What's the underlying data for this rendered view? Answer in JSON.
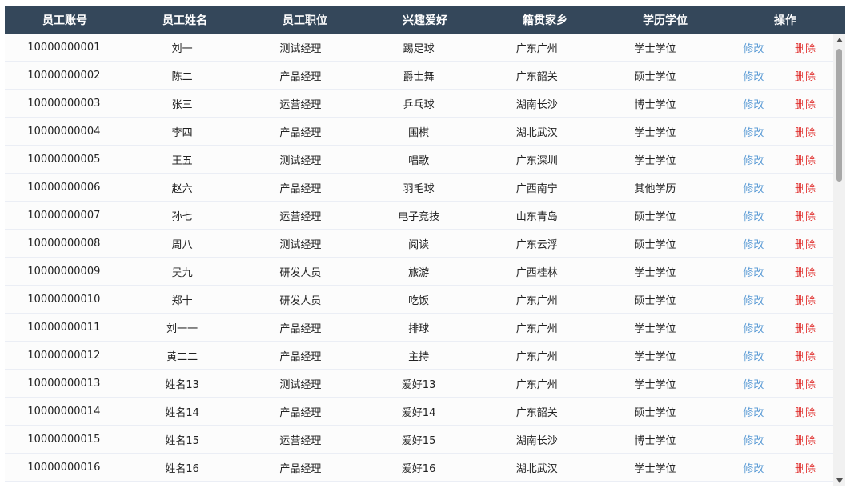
{
  "colors": {
    "header_bg": "#34475a",
    "edit_link": "#5b9bd5",
    "delete_link": "#e0302e"
  },
  "columns": [
    "员工账号",
    "员工姓名",
    "员工职位",
    "兴趣爱好",
    "籍贯家乡",
    "学历学位",
    "操作"
  ],
  "actions": {
    "edit": "修改",
    "delete": "删除"
  },
  "rows": [
    [
      "10000000001",
      "刘一",
      "测试经理",
      "踢足球",
      "广东广州",
      "学士学位"
    ],
    [
      "10000000002",
      "陈二",
      "产品经理",
      "爵士舞",
      "广东韶关",
      "硕士学位"
    ],
    [
      "10000000003",
      "张三",
      "运营经理",
      "乒乓球",
      "湖南长沙",
      "博士学位"
    ],
    [
      "10000000004",
      "李四",
      "产品经理",
      "围棋",
      "湖北武汉",
      "学士学位"
    ],
    [
      "10000000005",
      "王五",
      "测试经理",
      "唱歌",
      "广东深圳",
      "学士学位"
    ],
    [
      "10000000006",
      "赵六",
      "产品经理",
      "羽毛球",
      "广西南宁",
      "其他学历"
    ],
    [
      "10000000007",
      "孙七",
      "运营经理",
      "电子竞技",
      "山东青岛",
      "硕士学位"
    ],
    [
      "10000000008",
      "周八",
      "测试经理",
      "阅读",
      "广东云浮",
      "硕士学位"
    ],
    [
      "10000000009",
      "吴九",
      "研发人员",
      "旅游",
      "广西桂林",
      "学士学位"
    ],
    [
      "10000000010",
      "郑十",
      "研发人员",
      "吃饭",
      "广东广州",
      "硕士学位"
    ],
    [
      "10000000011",
      "刘一一",
      "产品经理",
      "排球",
      "广东广州",
      "学士学位"
    ],
    [
      "10000000012",
      "黄二二",
      "产品经理",
      "主持",
      "广东广州",
      "学士学位"
    ],
    [
      "10000000013",
      "姓名13",
      "测试经理",
      "爱好13",
      "广东广州",
      "学士学位"
    ],
    [
      "10000000014",
      "姓名14",
      "产品经理",
      "爱好14",
      "广东韶关",
      "硕士学位"
    ],
    [
      "10000000015",
      "姓名15",
      "运营经理",
      "爱好15",
      "湖南长沙",
      "博士学位"
    ],
    [
      "10000000016",
      "姓名16",
      "产品经理",
      "爱好16",
      "湖北武汉",
      "学士学位"
    ]
  ]
}
